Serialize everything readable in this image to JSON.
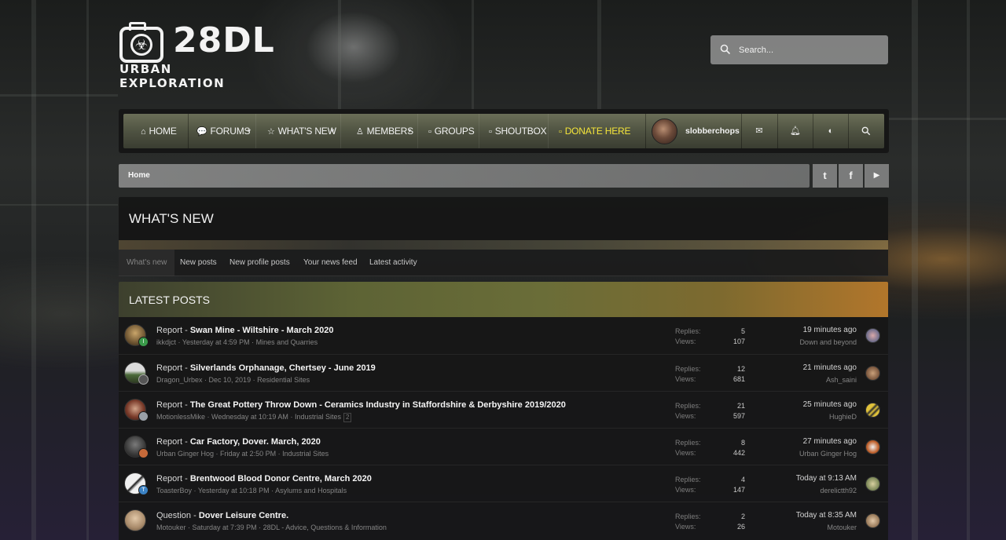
{
  "brand": {
    "logo_main": "28DL",
    "logo_sub": "URBAN EXPLORATION"
  },
  "search": {
    "placeholder": "Search..."
  },
  "nav": {
    "items": [
      {
        "label": "HOME",
        "icon": "home-icon"
      },
      {
        "label": "FORUMS",
        "icon": "comments-icon"
      },
      {
        "label": "WHAT'S NEW",
        "icon": "star-icon"
      },
      {
        "label": "MEMBERS",
        "icon": "user-icon"
      },
      {
        "label": "GROUPS",
        "icon": "square-icon"
      },
      {
        "label": "SHOUTBOX",
        "icon": "square-icon"
      },
      {
        "label": "DONATE HERE",
        "icon": "square-icon"
      }
    ],
    "username": "slobberchops",
    "donate_color": "#f5e53a"
  },
  "breadcrumb": {
    "home": "Home"
  },
  "social": {
    "twitter": "t",
    "facebook": "f",
    "youtube": "▶"
  },
  "page": {
    "title": "WHAT'S NEW"
  },
  "tabs": [
    "What's new",
    "New posts",
    "New profile posts",
    "Your news feed",
    "Latest activity"
  ],
  "section": {
    "title": "LATEST POSTS"
  },
  "labels": {
    "replies": "Replies:",
    "views": "Views:"
  },
  "posts": [
    {
      "prefix": "Report",
      "sep": " - ",
      "title": "Swan Mine - Wiltshire - March 2020",
      "author": "ikkdjct",
      "date": "Yesterday at 4:59 PM",
      "forum": "Mines and Quarries",
      "pages": "",
      "replies": "5",
      "views": "107",
      "last_time": "19 minutes ago",
      "last_user": "Down and beyond",
      "badge": "I",
      "badge_color": "#3a9a4a"
    },
    {
      "prefix": "Report",
      "sep": " - ",
      "title": "Silverlands Orphanage, Chertsey - June 2019",
      "author": "Dragon_Urbex",
      "date": "Dec 10, 2019",
      "forum": "Residential Sites",
      "pages": "",
      "replies": "12",
      "views": "681",
      "last_time": "21 minutes ago",
      "last_user": "Ash_saini",
      "badge": "",
      "badge_color": "#888888"
    },
    {
      "prefix": "Report",
      "sep": " - ",
      "title": "The Great Pottery Throw Down - Ceramics Industry in Staffordshire & Derbyshire 2019/2020",
      "author": "MotionlessMike",
      "date": "Wednesday at 10:19 AM",
      "forum": "Industrial Sites",
      "pages": "2",
      "replies": "21",
      "views": "597",
      "last_time": "25 minutes ago",
      "last_user": "HughieD",
      "badge": "",
      "badge_color": "#9aa0a8"
    },
    {
      "prefix": "Report",
      "sep": " - ",
      "title": "Car Factory, Dover. March, 2020",
      "author": "Urban Ginger Hog",
      "date": "Friday at 2:50 PM",
      "forum": "Industrial Sites",
      "pages": "",
      "replies": "8",
      "views": "442",
      "last_time": "27 minutes ago",
      "last_user": "Urban Ginger Hog",
      "badge": "",
      "badge_color": "#c66a3a"
    },
    {
      "prefix": "Report",
      "sep": " - ",
      "title": "Brentwood Blood Donor Centre, March 2020",
      "author": "ToasterBoy",
      "date": "Yesterday at 10:18 PM",
      "forum": "Asylums and Hospitals",
      "pages": "",
      "replies": "4",
      "views": "147",
      "last_time": "Today at 9:13 AM",
      "last_user": "derelictth92",
      "badge": "T",
      "badge_color": "#3b82c4"
    },
    {
      "prefix": "Question",
      "sep": " - ",
      "title": "Dover Leisure Centre.",
      "author": "Motouker",
      "date": "Saturday at 7:39 PM",
      "forum": "28DL",
      "forum2": "Advice, Questions & Information",
      "pages": "",
      "replies": "2",
      "views": "26",
      "last_time": "Today at 8:35 AM",
      "last_user": "Motouker",
      "badge": "",
      "badge_color": ""
    }
  ]
}
